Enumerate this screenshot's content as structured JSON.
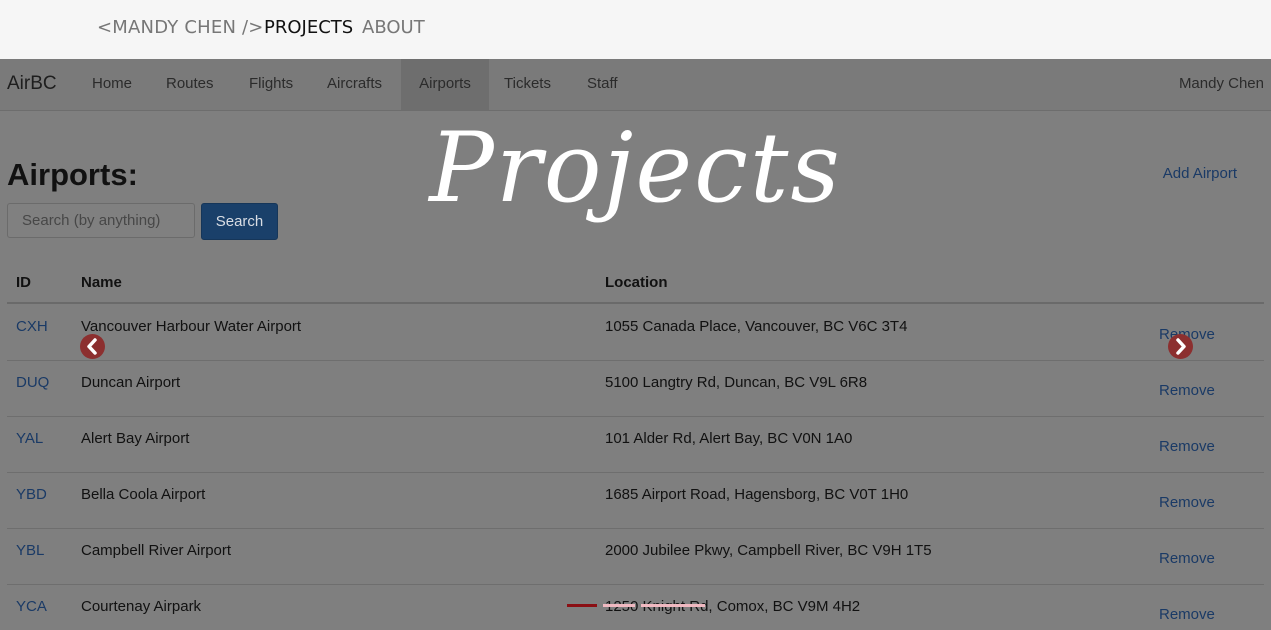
{
  "site_nav": {
    "brand": "<MANDY CHEN />",
    "links": [
      "PROJECTS",
      "ABOUT"
    ]
  },
  "app": {
    "brand": "AirBC",
    "nav_items": [
      "Home",
      "Routes",
      "Flights",
      "Aircrafts",
      "Airports",
      "Tickets",
      "Staff"
    ],
    "active_item": "Airports",
    "user": "Mandy Chen",
    "page_title": "Airports:",
    "add_link": "Add Airport",
    "search_placeholder": "Search (by anything)",
    "search_button": "Search",
    "columns": [
      "ID",
      "Name",
      "Location"
    ],
    "rows": [
      {
        "id": "CXH",
        "name": "Vancouver Harbour Water Airport",
        "location": "1055 Canada Place, Vancouver, BC V6C 3T4",
        "action": "Remove"
      },
      {
        "id": "DUQ",
        "name": "Duncan Airport",
        "location": "5100 Langtry Rd, Duncan, BC V9L 6R8",
        "action": "Remove"
      },
      {
        "id": "YAL",
        "name": "Alert Bay Airport",
        "location": "101 Alder Rd, Alert Bay, BC V0N 1A0",
        "action": "Remove"
      },
      {
        "id": "YBD",
        "name": "Bella Coola Airport",
        "location": "1685 Airport Road, Hagensborg, BC V0T 1H0",
        "action": "Remove"
      },
      {
        "id": "YBL",
        "name": "Campbell River Airport",
        "location": "2000 Jubilee Pkwy, Campbell River, BC V9H 1T5",
        "action": "Remove"
      },
      {
        "id": "YCA",
        "name": "Courtenay Airpark",
        "location": "1250 Knight Rd, Comox, BC V9M 4H2",
        "action": "Remove"
      }
    ]
  },
  "overlay": {
    "title": "Projects"
  },
  "carousel": {
    "prev_icon": "chevron-left-icon",
    "next_icon": "chevron-right-icon",
    "indicator_count": 3,
    "active_indicator": 1
  },
  "colors": {
    "accent_red": "#8c2f2f",
    "link_blue": "#1a3a66",
    "indicator_active": "#8b0f14",
    "indicator_inactive": "#f0b9c1"
  }
}
